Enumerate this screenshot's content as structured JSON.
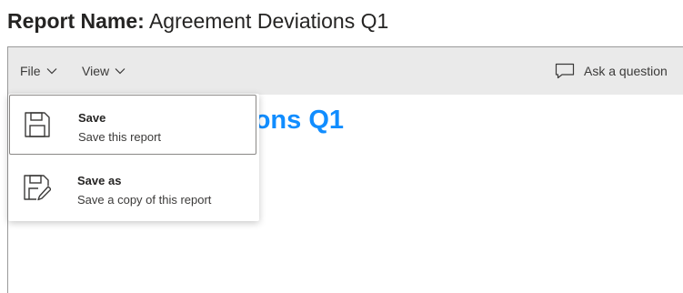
{
  "report": {
    "label": "Report Name:",
    "name": "Agreement Deviations Q1"
  },
  "toolbar": {
    "file_label": "File",
    "view_label": "View",
    "ask_label": "Ask a question"
  },
  "canvas": {
    "title_visible_fragment": "tions Q1"
  },
  "file_menu": {
    "items": [
      {
        "title": "Save",
        "description": "Save this report",
        "icon": "floppy-disk-icon"
      },
      {
        "title": "Save as",
        "description": "Save a copy of this report",
        "icon": "floppy-disk-edit-icon"
      }
    ]
  },
  "colors": {
    "toolbar_bg": "#eaeaea",
    "canvas_title": "#118dff",
    "text": "#252423"
  }
}
